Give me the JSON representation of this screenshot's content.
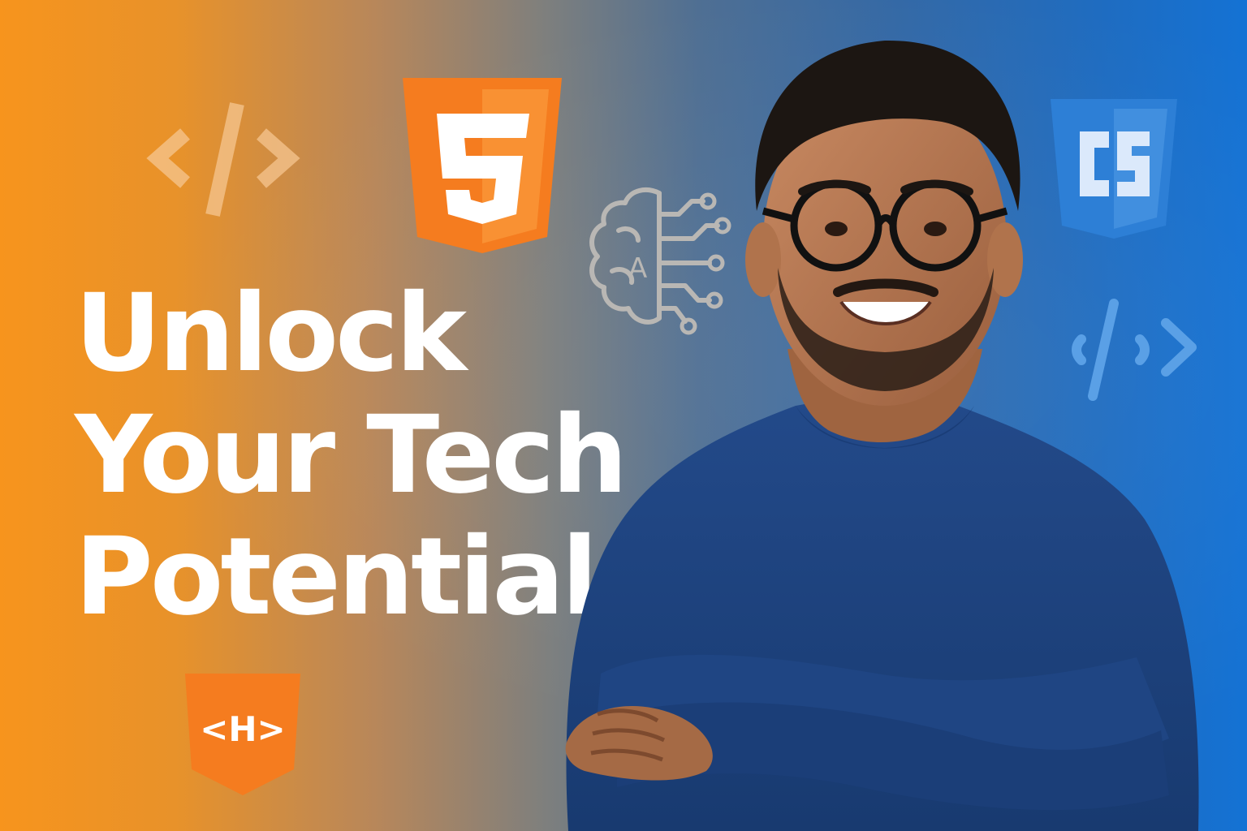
{
  "headline": {
    "line1": "Unlock",
    "line2": "Your Tech",
    "line3": "Potential"
  },
  "icons": {
    "html5": {
      "name": "html5-logo",
      "glyph": "5"
    },
    "css": {
      "name": "css-logo",
      "glyph": "C5"
    },
    "h_badge": {
      "name": "html-tag-badge",
      "glyph": "<H>"
    },
    "brain": {
      "name": "ai-brain-circuit",
      "glyph": "A"
    },
    "code_left": {
      "name": "code-brackets"
    },
    "code_right": {
      "name": "code-brackets"
    }
  },
  "colors": {
    "orange": "#f7941d",
    "blue": "#1472d4",
    "html_orange": "#f57c1f",
    "css_blue": "#2d7fd6",
    "sweater": "#1d3f7a"
  }
}
